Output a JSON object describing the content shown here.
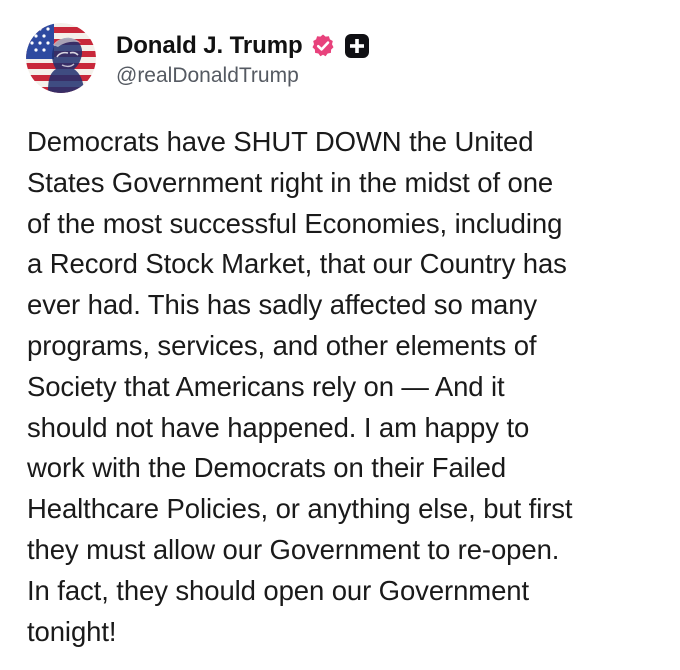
{
  "post": {
    "author": {
      "display_name": "Donald J. Trump",
      "handle": "@realDonaldTrump",
      "avatar_icon": "stars-and-stripes-portrait-avatar",
      "verified_icon": "verified-badge-icon",
      "badge_icon": "plus-badge-icon",
      "verified_color": "#e8427c",
      "badge_color": "#101014"
    },
    "body": "Democrats have SHUT DOWN the United\nStates Government right in the midst of one\nof the most successful Economies, including\na Record Stock Market, that our Country has\never had. This has sadly affected so many\nprograms, services, and other elements of\nSociety that Americans rely on — And it\nshould not have happened. I am happy to\nwork with the Democrats on their Failed\nHealthcare Policies, or anything else, but first\nthey must allow our Government to re-open.\nIn fact, they should open our Government\ntonight!"
  }
}
